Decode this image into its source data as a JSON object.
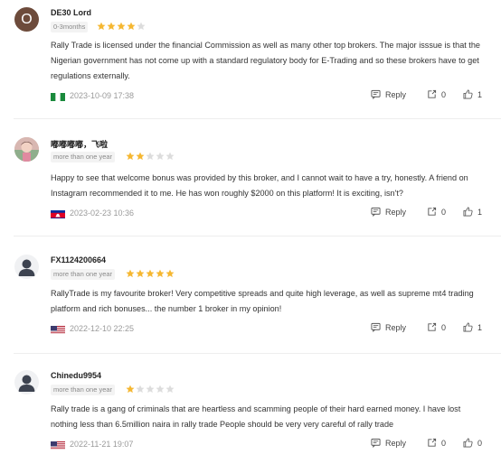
{
  "reviews": [
    {
      "name": "DE30 Lord",
      "badge": "0-3months",
      "avatar_letter": "O",
      "avatar_type": "letter",
      "rating": 4,
      "text": "Rally Trade is licensed under the financial Commission as well as many other top brokers. The major isssue is that the Nigerian government has not come up with a standard regulatory body for E-Trading and so these brokers have to get regulations externally.",
      "flag": "nigeria",
      "date": "2023-10-09 17:38",
      "reply_label": "Reply",
      "shares": "0",
      "likes": "1"
    },
    {
      "name": "嘟嘟嘟嘟，飞啦",
      "badge": "more than one year",
      "avatar_type": "photo",
      "rating": 2,
      "text": "Happy to see that welcome bonus was provided by this broker, and I cannot wait to have a try, honestly. A friend on Instagram recommended it to me. He has won roughly $2000 on this platform! It is exciting, isn't?",
      "flag": "cambodia",
      "date": "2023-02-23 10:36",
      "reply_label": "Reply",
      "shares": "0",
      "likes": "1"
    },
    {
      "name": "FX1124200664",
      "badge": "more than one year",
      "avatar_type": "default",
      "rating": 5,
      "text": "RallyTrade is my favourite broker! Very competitive spreads and quite high leverage, as well as supreme mt4 trading platform and rich bonuses... the number 1 broker in my opinion!",
      "flag": "usa",
      "date": "2022-12-10 22:25",
      "reply_label": "Reply",
      "shares": "0",
      "likes": "1"
    },
    {
      "name": "Chinedu9954",
      "badge": "more than one year",
      "avatar_type": "default",
      "rating": 1,
      "text": "Rally trade is a gang of criminals that are heartless and scamming people of their hard earned money. I have lost nothing less than 6.5million naira in rally trade People should be very very careful of rally trade",
      "flag": "usa",
      "date": "2022-11-21 19:07",
      "reply_label": "Reply",
      "shares": "0",
      "likes": "0"
    }
  ],
  "colors": {
    "star_filled": "#f5b731",
    "star_empty": "#dcdcdc",
    "divider": "#eeeeee"
  }
}
